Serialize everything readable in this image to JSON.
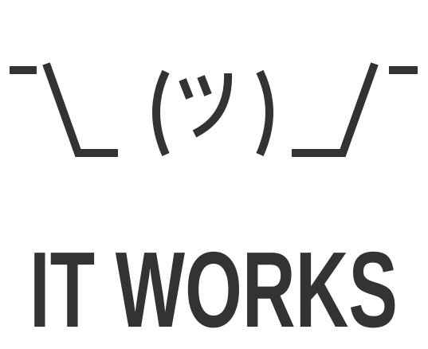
{
  "meme": {
    "emoticon": "¯\\_(ツ)_/¯",
    "caption": "IT WORKS",
    "ink_color": "#333333",
    "background_color": "#ffffff"
  }
}
